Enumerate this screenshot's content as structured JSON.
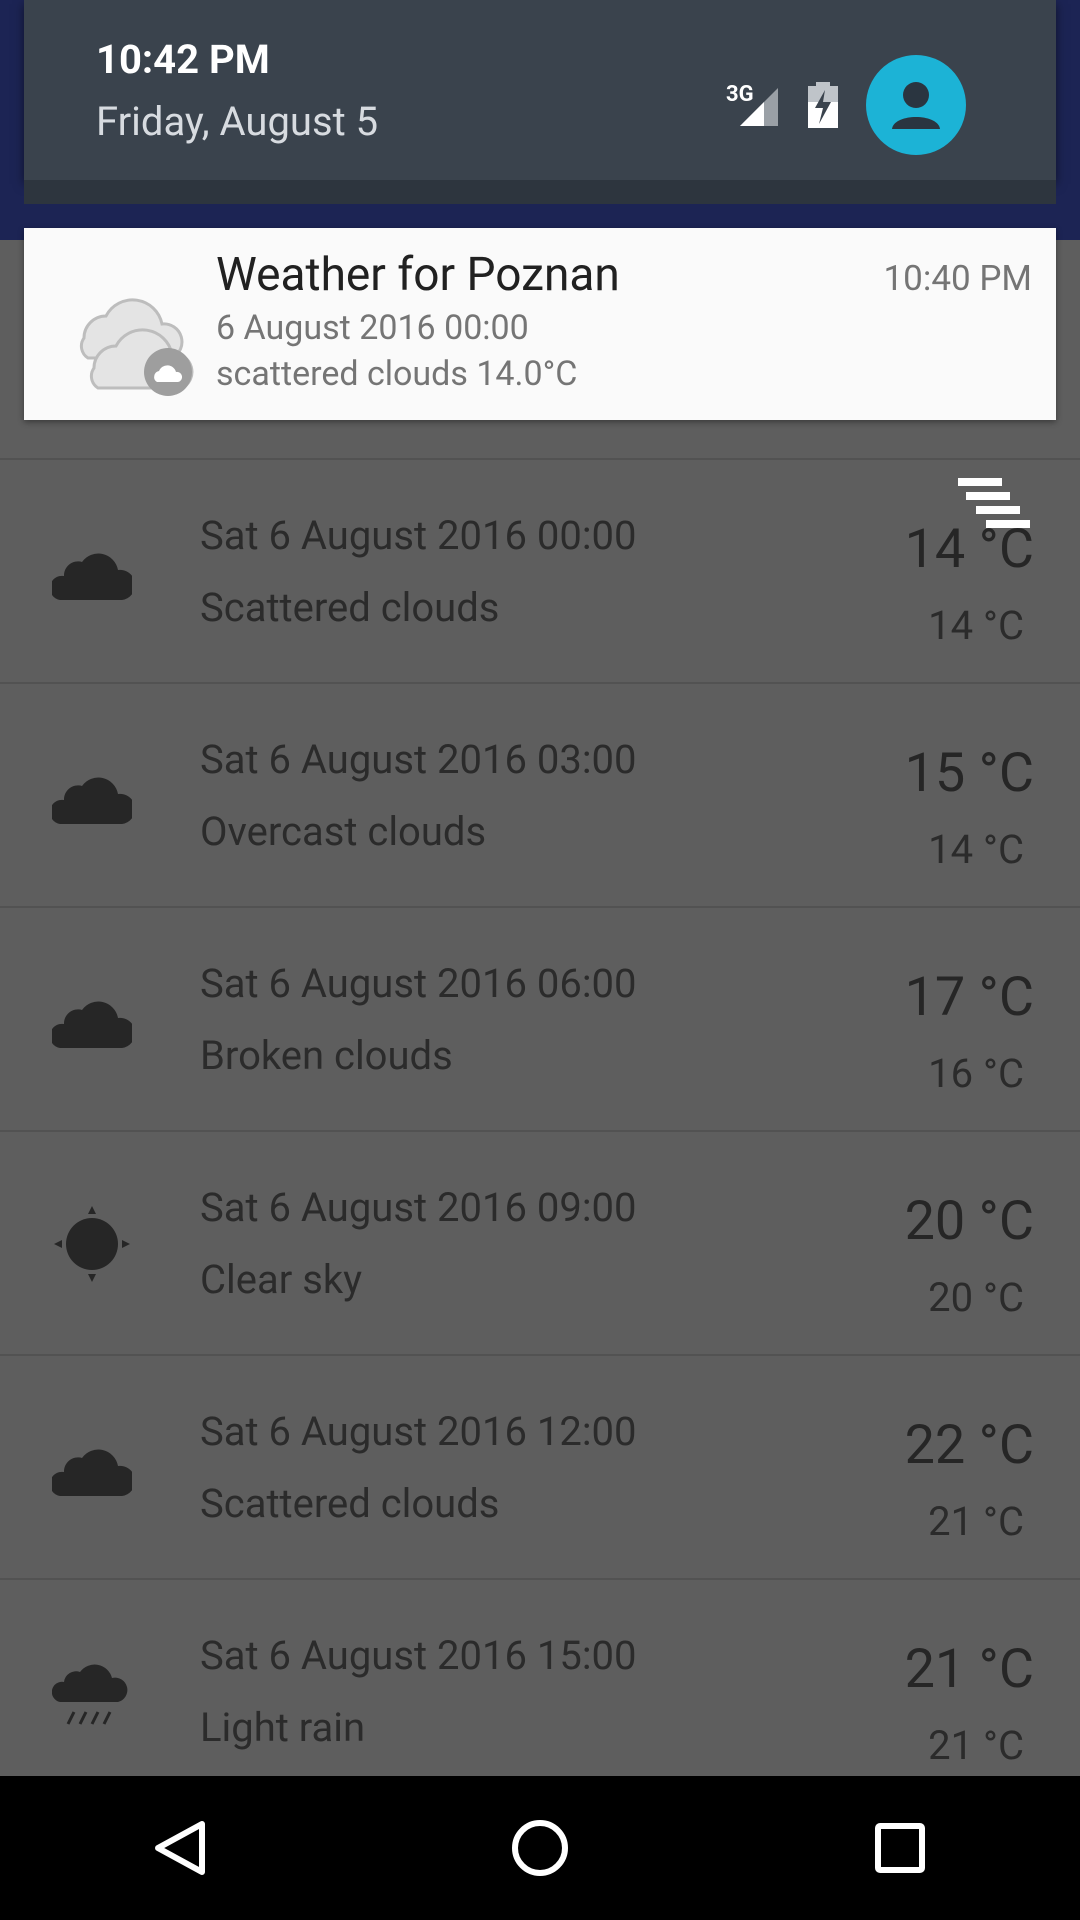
{
  "status": {
    "time": "10:42 PM",
    "date": "Friday, August 5",
    "network": "3G"
  },
  "notification": {
    "title": "Weather for Poznan",
    "time": "10:40 PM",
    "line1": "6 August 2016 00:00",
    "line2": "scattered clouds 14.0°C",
    "icon": "cloud-icon"
  },
  "forecast": [
    {
      "date": "Sat 6 August 2016 00:00",
      "desc": "Scattered clouds",
      "temp": "14 °C",
      "min": "14 °C",
      "icon": "cloud-icon"
    },
    {
      "date": "Sat 6 August 2016 03:00",
      "desc": "Overcast clouds",
      "temp": "15 °C",
      "min": "14 °C",
      "icon": "cloud-icon"
    },
    {
      "date": "Sat 6 August 2016 06:00",
      "desc": "Broken clouds",
      "temp": "17 °C",
      "min": "16 °C",
      "icon": "cloud-icon"
    },
    {
      "date": "Sat 6 August 2016 09:00",
      "desc": "Clear sky",
      "temp": "20 °C",
      "min": "20 °C",
      "icon": "sun-icon"
    },
    {
      "date": "Sat 6 August 2016 12:00",
      "desc": "Scattered clouds",
      "temp": "22 °C",
      "min": "21 °C",
      "icon": "cloud-icon"
    },
    {
      "date": "Sat 6 August 2016 15:00",
      "desc": "Light rain",
      "temp": "21 °C",
      "min": "21 °C",
      "icon": "rain-icon"
    }
  ],
  "colors": {
    "accent": "#1cb3d6",
    "shade": "#3a434d",
    "app_bar": "#1c2454"
  },
  "navbar": {
    "back": "back-icon",
    "home": "home-icon",
    "recents": "recents-icon"
  }
}
